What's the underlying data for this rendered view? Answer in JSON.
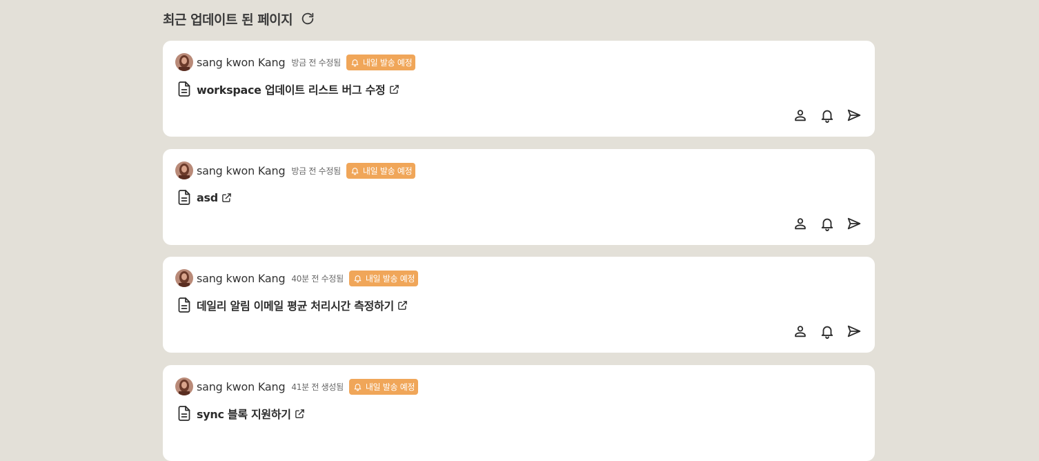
{
  "section": {
    "title": "최근 업데이트 된 페이지"
  },
  "cards": [
    {
      "author": "sang kwon Kang",
      "time": "방금 전 수정됨",
      "badge": "내일 발송 예정",
      "title": "workspace 업데이트 리스트 버그 수정"
    },
    {
      "author": "sang kwon Kang",
      "time": "방금 전 수정됨",
      "badge": "내일 발송 예정",
      "title": "asd"
    },
    {
      "author": "sang kwon Kang",
      "time": "40분 전 수정됨",
      "badge": "내일 발송 예정",
      "title": "데일리 알림 이메일 평균 처리시간 측정하기"
    },
    {
      "author": "sang kwon Kang",
      "time": "41분 전 생성됨",
      "badge": "내일 발송 예정",
      "title": "sync 블록 지원하기"
    }
  ],
  "colors": {
    "background": "#e3e0d8",
    "card": "#ffffff",
    "badge": "#f0a659",
    "text": "#2b2b2b"
  },
  "icons": {
    "refresh": "refresh-icon",
    "document": "document-icon",
    "external_link": "external-link-icon",
    "bell": "bell-icon",
    "person": "person-icon",
    "send": "send-icon"
  }
}
